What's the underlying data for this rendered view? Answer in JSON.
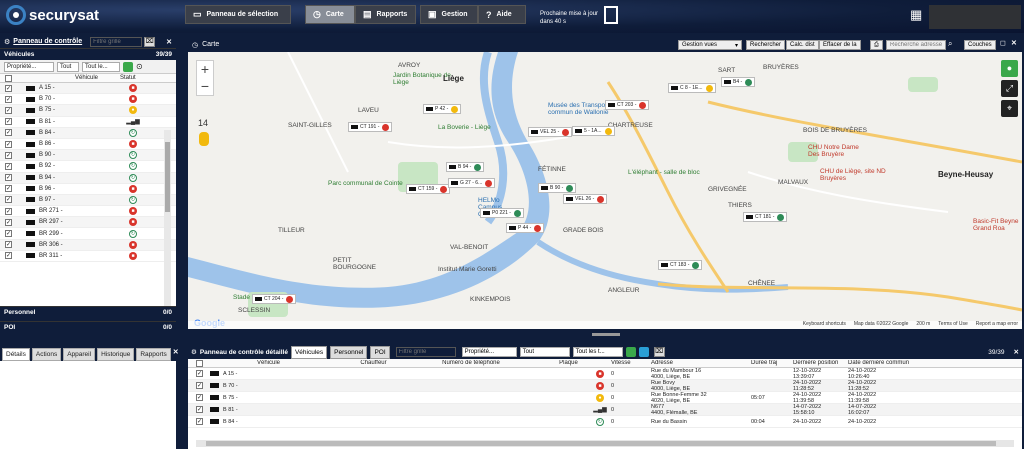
{
  "app": {
    "logo_text": "securysat",
    "brand_color": "#0f1d3a"
  },
  "nav": {
    "panel": "Panneau de sélection",
    "map": "Carte",
    "reports": "Rapports",
    "manage": "Gestion",
    "help": "Aide",
    "refresh_line1": "Prochaine mise à jour",
    "refresh_line2": "dans 40 s"
  },
  "left": {
    "title": "Panneau de contrôle",
    "filter_placeholder": "Filtre grille",
    "vehicles_label": "Véhicules",
    "vehicles_count": "39/39",
    "owner_select": "Propriété...",
    "all1": "Tout",
    "all2": "Tout le...",
    "col_vehicle": "Véhicule",
    "col_status": "Statut",
    "rows": [
      {
        "name": "A 15 -",
        "status": "red"
      },
      {
        "name": "B 70 -",
        "status": "red"
      },
      {
        "name": "B 75 -",
        "status": "yel"
      },
      {
        "name": "B 81 -",
        "status": "sig"
      },
      {
        "name": "B 84 -",
        "status": "grn"
      },
      {
        "name": "B 86 -",
        "status": "red"
      },
      {
        "name": "B 90 -",
        "status": "grn"
      },
      {
        "name": "B 92 -",
        "status": "grn"
      },
      {
        "name": "B 94 -",
        "status": "grn"
      },
      {
        "name": "B 96 -",
        "status": "red"
      },
      {
        "name": "B 97 -",
        "status": "grn"
      },
      {
        "name": "BR 271 -",
        "status": "red"
      },
      {
        "name": "BR 297 -",
        "status": "red"
      },
      {
        "name": "BR 299 -",
        "status": "grn"
      },
      {
        "name": "BR 306 -",
        "status": "red"
      },
      {
        "name": "BR 311 -",
        "status": "red"
      }
    ],
    "personnel_label": "Personnel",
    "personnel_count": "0/0",
    "poi_label": "POI",
    "poi_count": "0/0"
  },
  "detail_tabs": [
    "Détails",
    "Actions",
    "Appareil",
    "Historique",
    "Rapports"
  ],
  "map": {
    "title": "Carte",
    "btn_views": "Gestion vues",
    "btn_search": "Rechercher",
    "btn_calc": "Calc. dist",
    "btn_clear": "Effacer de la",
    "search_placeholder": "Recherche adresse",
    "btn_layers": "Couches",
    "zoom_level": "14",
    "labels": {
      "avroy": "AVROY",
      "jardin": "Jardin Botanique de Liège",
      "liege": "Liège",
      "laveu": "LAVEU",
      "stgilles": "SAINT-GILLES",
      "musee": "Musée des Transports en commun de Wallonie",
      "boverie": "La Boverie - Liège",
      "chartreuse": "CHARTREUSE",
      "parc": "Parc communal de Cointe",
      "fetinne": "FÉTINNE",
      "elephant": "L'éléphant - salle de bloc",
      "grivegnee": "GRIVEGNÉE",
      "bruyeres": "BRUYÈRES",
      "boisdebruyeres": "BOIS DE BRUYÈRES",
      "chu1": "CHU Notre Dame Des Bruyère",
      "chu2": "CHU de Liège, site ND Bruyères",
      "beyne": "Beyne-Heusay",
      "malvaux": "MALVAUX",
      "thiers": "THIERS",
      "basic": "Basic-Fit Beyne Grand Roa",
      "tilleur": "TILLEUR",
      "petitbourgogne": "PETIT BOURGOGNE",
      "valbenoit": "VAL-BENOIT",
      "institut": "Institut Marie Goretti",
      "kinkempois": "KINKEMPOIS",
      "angleur": "ANGLEUR",
      "chenee": "CHÊNEE",
      "stade": "Stade du",
      "sclessin": "SCLESSIN",
      "gradbois": "GRADE BOIS",
      "campus": "HELMo Campus Ourthe",
      "sart": "SART"
    },
    "vehicles": [
      {
        "label": "CT 191 -",
        "dot": "#d9342b"
      },
      {
        "label": "P 42 -",
        "dot": "#f2b90d"
      },
      {
        "label": "CT 203 -",
        "dot": "#d9342b"
      },
      {
        "label": "C 8 - 1E...",
        "dot": "#f2b90d"
      },
      {
        "label": "B4 -",
        "dot": "#2e8b57"
      },
      {
        "label": "VEL 25 -",
        "dot": "#d9342b"
      },
      {
        "label": "5 - 1A...",
        "dot": "#f2b90d"
      },
      {
        "label": "B 94 -",
        "dot": "#2e8b57"
      },
      {
        "label": "CT 159 -",
        "dot": "#d9342b"
      },
      {
        "label": "G 27 - 6...",
        "dot": "#d9342b"
      },
      {
        "label": "B 90 -",
        "dot": "#2e8b57"
      },
      {
        "label": "VEL 26 -",
        "dot": "#d9342b"
      },
      {
        "label": "P0 221 -",
        "dot": "#2e8b57"
      },
      {
        "label": "P 44 -",
        "dot": "#d9342b"
      },
      {
        "label": "CT 181 -",
        "dot": "#2e8b57"
      },
      {
        "label": "CT 183 -",
        "dot": "#2e8b57"
      },
      {
        "label": "CT 204 -",
        "dot": "#d9342b"
      }
    ],
    "footer": {
      "shortcuts": "Keyboard shortcuts",
      "data": "Map data ©2022 Google",
      "scale": "200 m",
      "terms": "Terms of Use",
      "report": "Report a map error"
    },
    "google": "Google"
  },
  "bottom": {
    "title": "Panneau de contrôle détaillé",
    "tabs": [
      "Véhicules",
      "Personnel",
      "POI"
    ],
    "filter_placeholder": "Filtre grille",
    "owner": "Propriété...",
    "all": "Tout",
    "alltimes": "Tout les t...",
    "count": "39/39",
    "cols": [
      "Véhicule",
      "Chauffeur",
      "Numéro de téléphone",
      "Plaque",
      "Vitesse",
      "Adresse",
      "Durée traj",
      "Dernière position",
      "Date dernière commun"
    ],
    "rows": [
      {
        "veh": "A 15 -",
        "status": "red",
        "speed": "0",
        "addr1": "Rue du Mambour 16",
        "addr2": "4000, Liège, BE",
        "dur": "",
        "pos1": "12-10-2022",
        "pos2": "13:39:07",
        "com1": "24-10-2022",
        "com2": "10:26:40"
      },
      {
        "veh": "B 70 -",
        "status": "red",
        "speed": "0",
        "addr1": "Rue Bovy",
        "addr2": "4000, Liège, BE",
        "dur": "",
        "pos1": "24-10-2022",
        "pos2": "11:28:52",
        "com1": "24-10-2022",
        "com2": "11:28:52"
      },
      {
        "veh": "B 75 -",
        "status": "yel",
        "speed": "0",
        "addr1": "Rue Bonne-Femme 32",
        "addr2": "4020, Liège, BE",
        "dur": "05:07",
        "pos1": "24-10-2022",
        "pos2": "11:39:58",
        "com1": "24-10-2022",
        "com2": "11:39:58"
      },
      {
        "veh": "B 81 -",
        "status": "sig",
        "speed": "0",
        "addr1": "N677",
        "addr2": "4400, Flémalle, BE",
        "dur": "",
        "pos1": "14-07-2022",
        "pos2": "15:58:10",
        "com1": "14-07-2022",
        "com2": "16:02:07"
      },
      {
        "veh": "B 84 -",
        "status": "grn",
        "speed": "0",
        "addr1": "Rue du Bassin",
        "addr2": "",
        "dur": "00:04",
        "pos1": "24-10-2022",
        "pos2": "",
        "com1": "24-10-2022",
        "com2": ""
      }
    ]
  }
}
